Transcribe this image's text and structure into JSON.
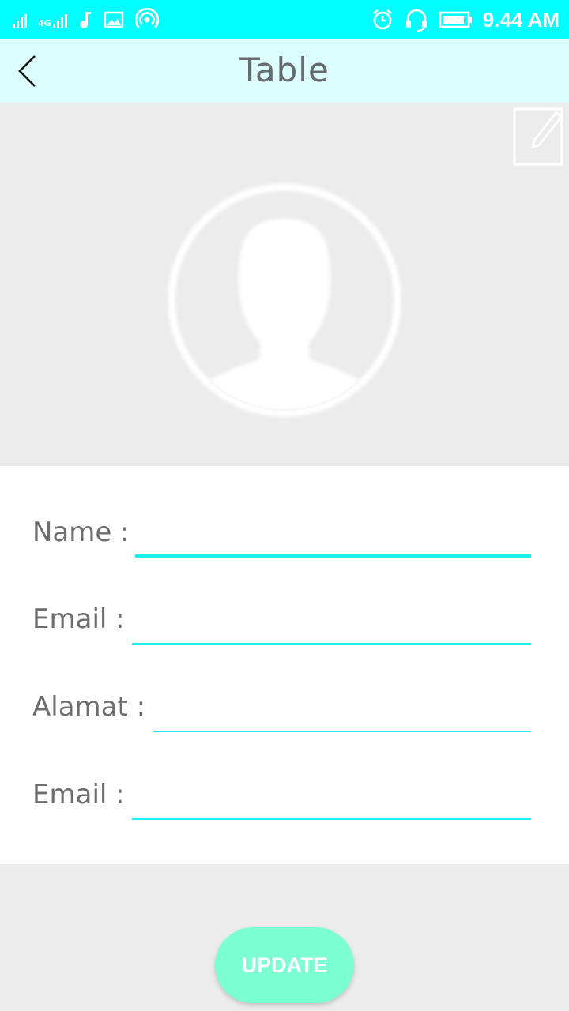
{
  "status_bar": {
    "network_type": "4G",
    "time": "9.44 AM",
    "icons": [
      "signal-icon",
      "4g-signal-icon",
      "music-icon",
      "image-icon",
      "hotspot-icon",
      "alarm-icon",
      "headset-icon",
      "battery-icon"
    ]
  },
  "app_bar": {
    "title": "Table",
    "back_icon": "chevron-left-icon"
  },
  "profile": {
    "avatar_icon": "user-avatar-icon",
    "edit_icon": "edit-icon"
  },
  "form": {
    "fields": [
      {
        "label": "Name :",
        "value": "",
        "focused": true
      },
      {
        "label": "Email :",
        "value": ""
      },
      {
        "label": "Alamat :",
        "value": ""
      },
      {
        "label": "Email :",
        "value": ""
      }
    ]
  },
  "actions": {
    "update_label": "UPDATE"
  },
  "colors": {
    "status_bar": "#00ffff",
    "app_bar": "#dcfeff",
    "accent_underline": "#1af0f0",
    "update_button": "#7dffd4",
    "background": "#ececec"
  }
}
